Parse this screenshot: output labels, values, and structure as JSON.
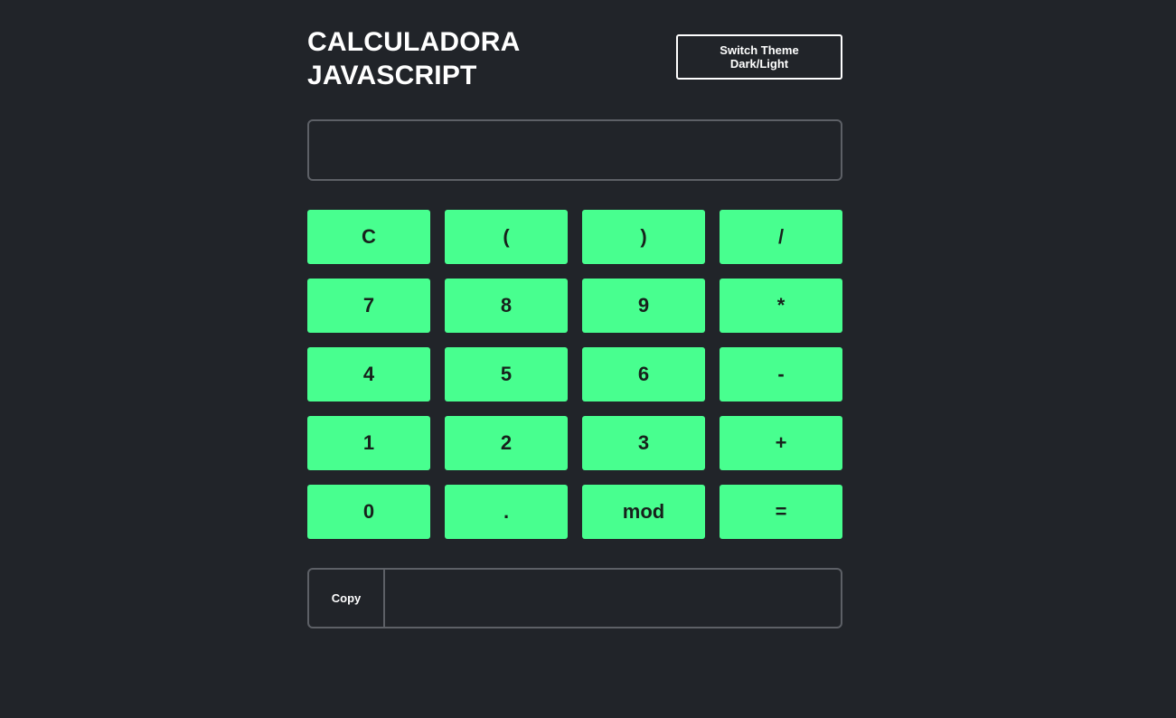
{
  "header": {
    "title_line1": "CALCULADORA",
    "title_line2": "JAVASCRIPT",
    "theme_button_line1": "Switch Theme",
    "theme_button_line2": "Dark/Light"
  },
  "display": {
    "value": "",
    "placeholder": ""
  },
  "keypad": {
    "keys": [
      "C",
      "(",
      ")",
      "/",
      "7",
      "8",
      "9",
      "*",
      "4",
      "5",
      "6",
      "-",
      "1",
      "2",
      "3",
      "+",
      "0",
      ".",
      "mod",
      "="
    ]
  },
  "result": {
    "copy_label": "Copy",
    "value": ""
  },
  "colors": {
    "background": "#212429",
    "key": "#48ff8f",
    "key_text": "#17211c",
    "border": "#5d6066",
    "text": "#ffffff"
  }
}
